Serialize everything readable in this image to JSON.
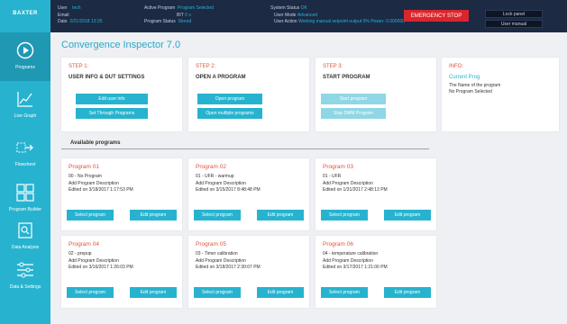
{
  "app": {
    "brand": "BAXTER"
  },
  "header": {
    "col1": {
      "user_k": "User",
      "user_v": "tech",
      "email_k": "Email",
      "date_k": "Date",
      "date_v": "2/21/2018 13:35"
    },
    "col2": {
      "program_k": "Active Program",
      "program_v": "Program Selected",
      "bit_k": "BIT",
      "bit_v": "0 s",
      "status_k": "Program Status",
      "status_v": "Stored"
    },
    "col3": {
      "sys_k": "System Status",
      "sys_v": "OK",
      "mode_k": "User Mode",
      "mode_v": "Advanced",
      "action_k": "User Action",
      "action_v": "Working manual setpoint output 0% Power: 0.000000"
    },
    "estop": "EMERGENCY STOP",
    "lock_panel": "Lock panel",
    "user_manual": "User manual"
  },
  "sidebar": {
    "items": [
      {
        "label": "Programs",
        "icon": "play-icon"
      },
      {
        "label": "Live Graph",
        "icon": "line-chart-icon"
      },
      {
        "label": "Flowsheet",
        "icon": "flowsheet-icon"
      },
      {
        "label": "Program Builder",
        "icon": "grid-icon"
      },
      {
        "label": "Data Analysis",
        "icon": "data-analysis-icon"
      },
      {
        "label": "Data & Settings",
        "icon": "sliders-icon"
      }
    ]
  },
  "main": {
    "title": "Convergence Inspector 7.0",
    "steps": [
      {
        "title": "STEP 1:",
        "subtitle": "USER INFO & DUT SETTINGS",
        "buttons": [
          "Edit user info",
          "Set Through Programs"
        ]
      },
      {
        "title": "STEP 2:",
        "subtitle": "OPEN A PROGRAM",
        "buttons": [
          "Open program",
          "Open multiple programs"
        ]
      },
      {
        "title": "STEP 3:",
        "subtitle": "START PROGRAM",
        "buttons": [
          "Start program",
          "Stop DMM Program"
        ]
      }
    ],
    "info": {
      "title": "INFO:",
      "link": "Current Prog",
      "line1": "The Name of the program",
      "line2": "No Program Selected"
    },
    "available_label": "Available programs",
    "programs": [
      {
        "name": "Program 01",
        "type": "00 - No Program",
        "desc": "Add Program Description",
        "edited": "Edited on 3/18/2017 1:17:53 PM",
        "select": "Select program",
        "edit": "Edit program"
      },
      {
        "name": "Program 02",
        "type": "01 - UFR - warmup",
        "desc": "Add Program Description",
        "edited": "Edited on 3/15/2017 8:48:48 PM",
        "select": "Select program",
        "edit": "Edit program"
      },
      {
        "name": "Program 03",
        "type": "01 - UFR",
        "desc": "Add Program Description",
        "edited": "Edited on 1/31/2017 2:48:13 PM",
        "select": "Select program",
        "edit": "Edit program"
      },
      {
        "name": "Program 04",
        "type": "02 - prepup",
        "desc": "Add Program Description",
        "edited": "Edited on 3/16/2017 1:26:03 PM",
        "select": "Select program",
        "edit": "Edit program"
      },
      {
        "name": "Program 05",
        "type": "03 - Timer calibration",
        "desc": "Add Program Description",
        "edited": "Edited on 3/18/2017 2:30:07 PM",
        "select": "Select program",
        "edit": "Edit program"
      },
      {
        "name": "Program 06",
        "type": "04 - temperature calibration",
        "desc": "Add Program Description",
        "edited": "Edited on 3/17/2017 1:21:00 PM",
        "select": "Select program",
        "edit": "Edit program"
      }
    ]
  },
  "colors": {
    "accent": "#27b3cf",
    "header": "#1c2a44",
    "estop": "#d9262c",
    "step_title": "#e0523b"
  }
}
